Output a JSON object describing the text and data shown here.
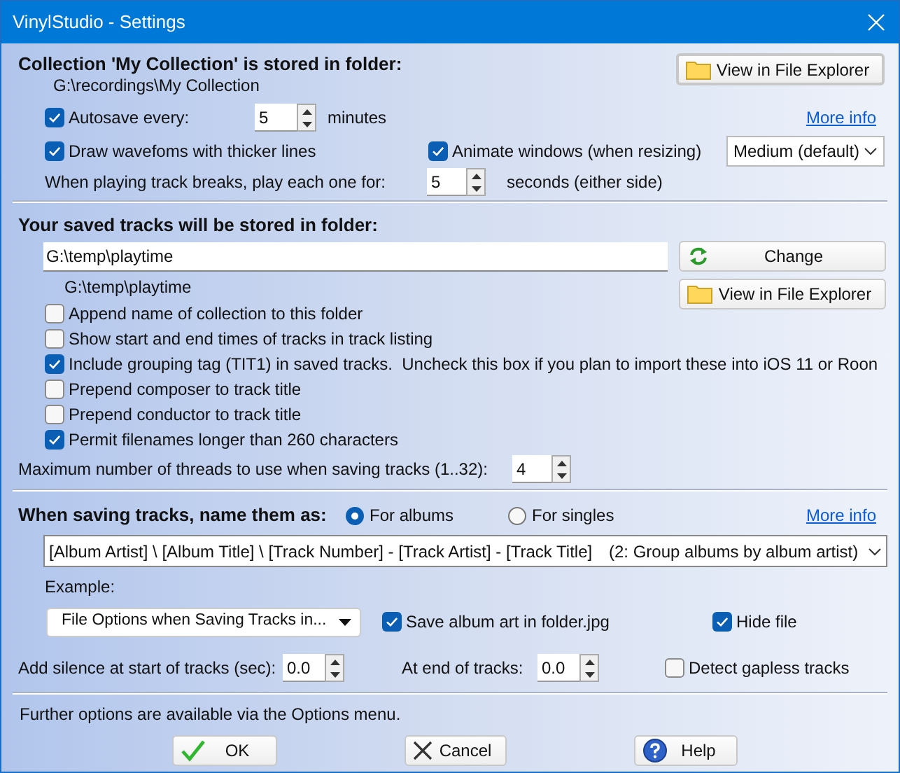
{
  "window": {
    "title": "VinylStudio - Settings"
  },
  "collection": {
    "heading": "Collection 'My Collection' is stored in folder:",
    "path": "G:\\recordings\\My Collection",
    "view_button": "View in File Explorer",
    "autosave": {
      "label": "Autosave every:",
      "checked": true,
      "value": "5",
      "unit": "minutes"
    },
    "more_info": "More info",
    "thick_waveforms": {
      "label": "Draw wavefoms with thicker lines",
      "checked": true
    },
    "animate": {
      "label": "Animate windows (when resizing)",
      "checked": true,
      "speed": "Medium (default)"
    },
    "track_breaks": {
      "label": "When playing track breaks, play each one for:",
      "value": "5",
      "unit": "seconds (either side)"
    }
  },
  "saved_tracks": {
    "heading": "Your saved tracks will be stored in folder:",
    "folder": "G:\\temp\\playtime",
    "path": "G:\\temp\\playtime",
    "change_button": "Change",
    "view_button": "View in File Explorer",
    "options": [
      {
        "label": "Append name of collection to this folder",
        "checked": false
      },
      {
        "label": "Show start and end times of tracks in track listing",
        "checked": false
      },
      {
        "label": "Include grouping tag (TIT1) in saved tracks.  Uncheck this box if you plan to import these into iOS 11 or Roon",
        "checked": true
      },
      {
        "label": "Prepend composer to track title",
        "checked": false
      },
      {
        "label": "Prepend conductor to track title",
        "checked": false
      },
      {
        "label": "Permit filenames longer than 260 characters",
        "checked": true
      }
    ],
    "threads": {
      "label": "Maximum number of threads to use when saving tracks (1..32):",
      "value": "4"
    }
  },
  "naming": {
    "heading": "When saving tracks, name them as:",
    "modes": [
      {
        "label": "For albums",
        "selected": true
      },
      {
        "label": "For singles",
        "selected": false
      }
    ],
    "more_info": "More info",
    "pattern": "[Album Artist] \\ [Album Title] \\ [Track Number] - [Track Artist] - [Track Title]",
    "pattern_note": "(2: Group albums by album artist)",
    "example_label": "Example:",
    "file_options": "File Options when Saving Tracks in...",
    "album_art": {
      "label": "Save album art in folder.jpg",
      "checked": true
    },
    "hide_file": {
      "label": "Hide file",
      "checked": true
    },
    "silence_start": {
      "label": "Add silence at start of tracks (sec):",
      "value": "0.0"
    },
    "silence_end": {
      "label": "At end of tracks:",
      "value": "0.0"
    },
    "gapless": {
      "label": "Detect gapless tracks",
      "checked": false
    }
  },
  "footer": {
    "note": "Further options are available via the Options menu.",
    "buttons": [
      {
        "label": "OK",
        "kind": "ok"
      },
      {
        "label": "Cancel",
        "kind": "cancel"
      },
      {
        "label": "Help",
        "kind": "help"
      }
    ]
  }
}
